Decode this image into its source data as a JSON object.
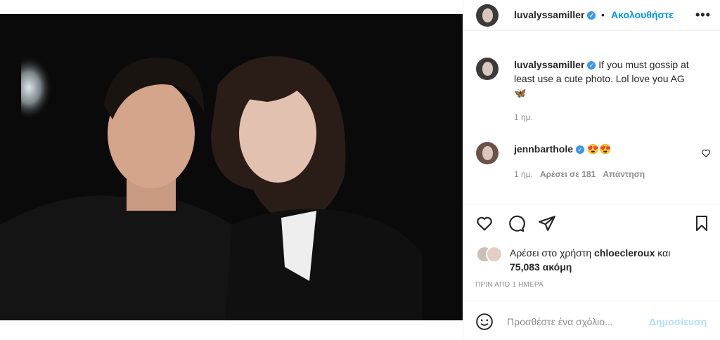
{
  "post": {
    "author": "luvalyssamiller",
    "follow_label": "Ακολουθήστε",
    "more_label": "•••",
    "separator": "•",
    "caption": "If you must gossip at least use a cute photo. Lol love you AG",
    "caption_emoji": "🦋",
    "caption_time": "1 ημ."
  },
  "comments": [
    {
      "author": "jennbarthole",
      "text": "😍😍",
      "time": "1 ημ.",
      "likes": "Αρέσει σε 181",
      "reply": "Απάντηση"
    }
  ],
  "actions": {
    "like_icon": "heart-icon",
    "comment_icon": "comment-icon",
    "share_icon": "paper-plane-icon",
    "save_icon": "bookmark-icon"
  },
  "likes": {
    "prefix": "Αρέσει στο χρήστη",
    "user": "chloecleroux",
    "joiner": "και",
    "count": "75,083 ακόμη"
  },
  "posted_ago": "ΠΡΙΝ ΑΠΟ 1 ΗΜΕΡΑ",
  "composer": {
    "placeholder": "Προσθέστε ένα σχόλιο...",
    "post_label": "Δημοσίευση",
    "emoji_icon": "smiley-icon"
  },
  "colors": {
    "accent": "#0095f6",
    "verified": "#3897f0",
    "muted": "#8e8e8e",
    "post_disabled": "#b2dffc",
    "heart_emoji": "#ed4956"
  }
}
